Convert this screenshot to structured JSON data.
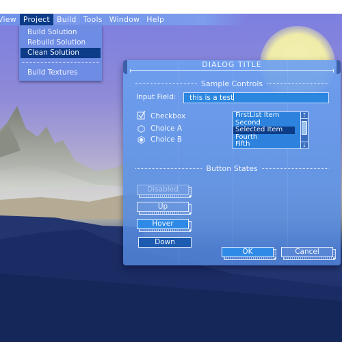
{
  "menubar": {
    "items": [
      {
        "label": "View"
      },
      {
        "label": "Project",
        "active": true
      },
      {
        "label": "Build"
      },
      {
        "label": "Tools"
      },
      {
        "label": "Window"
      },
      {
        "label": "Help"
      }
    ]
  },
  "project_menu": {
    "items": [
      {
        "label": "Build Solution"
      },
      {
        "label": "Rebuild Solution"
      },
      {
        "label": "Clean Solution",
        "selected": true
      },
      {
        "label": "Build Textures"
      }
    ]
  },
  "dialog": {
    "title": "DIALOG TITLE",
    "sample_controls_heading": "Sample Controls",
    "input_label": "Input Field:",
    "input_value": "this is a test",
    "checkbox_label": "Checkbox",
    "checkbox_checked": true,
    "radio_a_label": "Choice A",
    "radio_b_label": "Choice B",
    "radio_selected": "Choice B",
    "list_items": [
      "FirstList Item",
      "Second",
      "Selected Item",
      "Fourth",
      "Fifth"
    ],
    "list_selected_index": 2,
    "button_states_heading": "Button States",
    "buttons": {
      "disabled": "Disabled",
      "up": "Up",
      "hover": "Hover",
      "down": "Down"
    },
    "ok_label": "OK",
    "cancel_label": "Cancel"
  },
  "colors": {
    "menu_active": "#0c3b87",
    "dialog_blue": "#5f96e8",
    "button_hover": "#2e8ae6",
    "button_down": "#1d5bb0"
  }
}
